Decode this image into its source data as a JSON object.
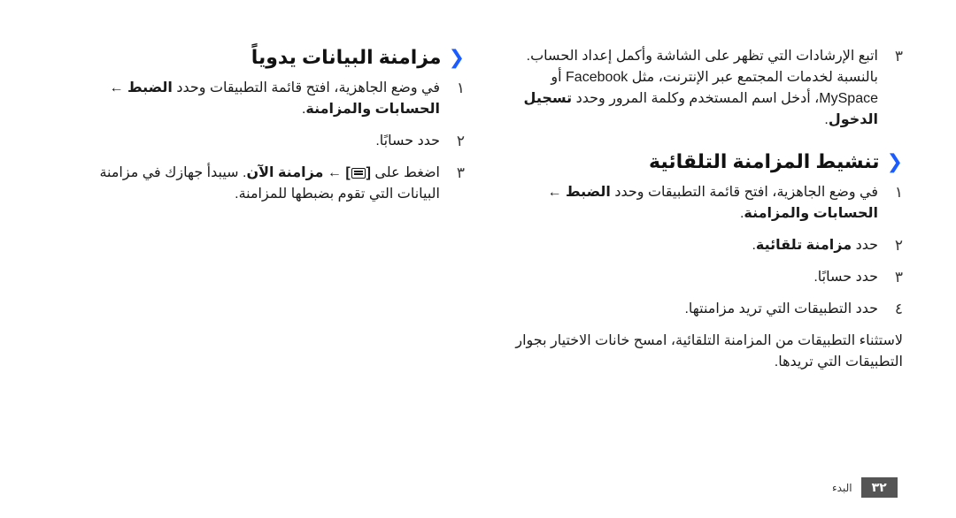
{
  "right_column": {
    "top_step": {
      "number": "٣",
      "text_before": "اتبع الإرشادات التي تظهر على الشاشة وأكمل إعداد الحساب. بالنسبة لخدمات المجتمع عبر الإنترنت، مثل Facebook أو MySpace، أدخل اسم المستخدم وكلمة المرور وحدد ",
      "bold": "تسجيل الدخول",
      "text_after": "."
    },
    "section_title": "تنشيط المزامنة التلقائية",
    "steps": [
      {
        "number": "١",
        "text_before": "في وضع الجاهزية، افتح قائمة التطبيقات وحدد ",
        "bold": "الضبط ← الحسابات والمزامنة",
        "text_after": "."
      },
      {
        "number": "٢",
        "text_before": "حدد ",
        "bold": "مزامنة تلقائية",
        "text_after": "."
      },
      {
        "number": "٣",
        "text_before": "حدد حسابًا.",
        "bold": "",
        "text_after": ""
      },
      {
        "number": "٤",
        "text_before": "حدد التطبيقات التي تريد مزامنتها.",
        "bold": "",
        "text_after": ""
      }
    ],
    "note": "لاستثناء التطبيقات من المزامنة التلقائية، امسح خانات الاختيار بجوار التطبيقات التي تريدها."
  },
  "left_column": {
    "section_title": "مزامنة البيانات يدوياً",
    "steps": [
      {
        "number": "١",
        "text_before": "في وضع الجاهزية، افتح قائمة التطبيقات وحدد ",
        "bold": "الضبط ← الحسابات والمزامنة",
        "text_after": "."
      },
      {
        "number": "٢",
        "text_before": "حدد حسابًا.",
        "bold": "",
        "text_after": ""
      },
      {
        "number": "٣",
        "text_before": "اضغط على ",
        "menu_key": "menu-icon",
        "bold": " ← مزامنة الآن",
        "text_after": ". سيبدأ جهازك في مزامنة البيانات التي تقوم بضبطها للمزامنة."
      }
    ]
  },
  "footer": {
    "page_number": "٣٢",
    "chapter_label": "البدء"
  },
  "colors": {
    "accent_chevron": "#1a5cff",
    "page_box": "#555555"
  }
}
